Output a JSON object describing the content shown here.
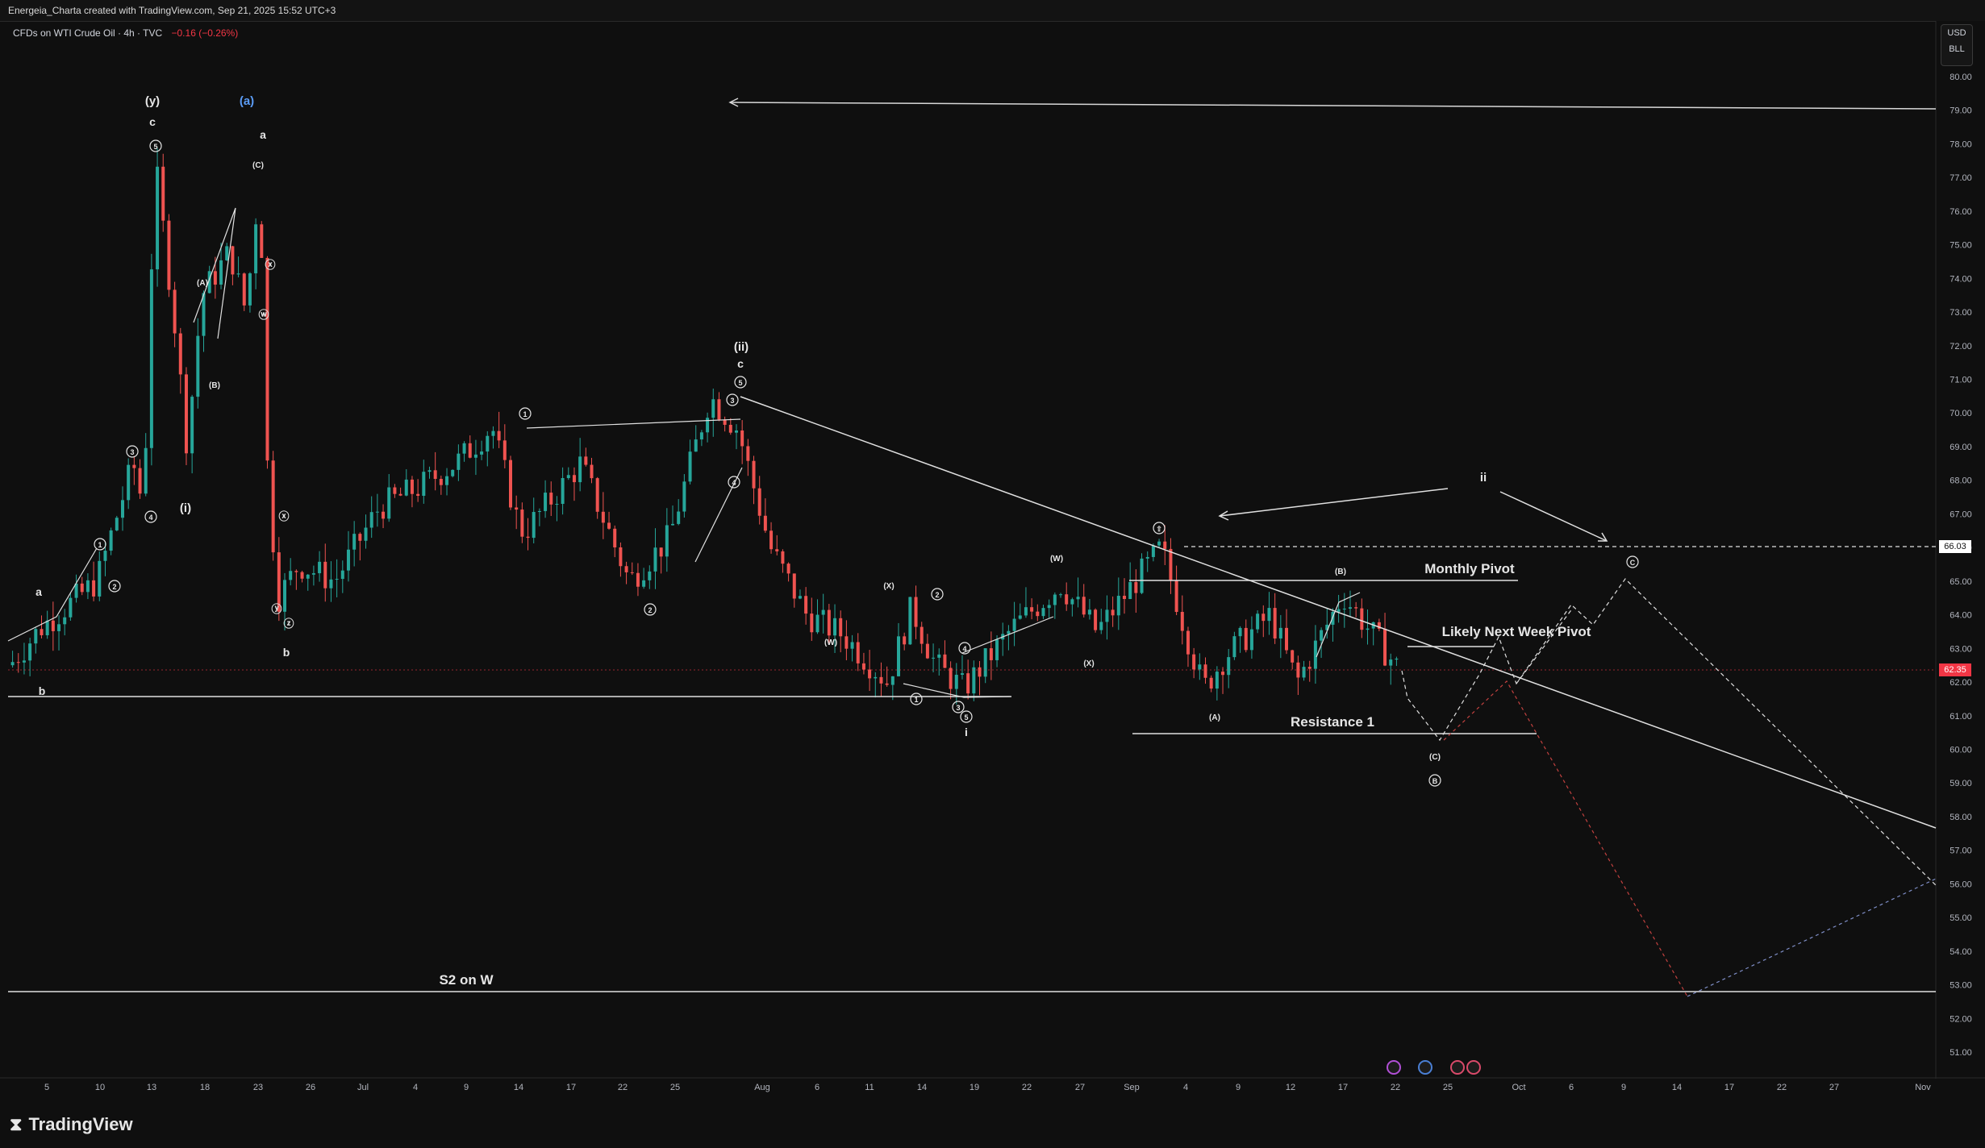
{
  "header": {
    "credit": "Energeia_Charta created with TradingView.com, Sep 21, 2025 15:52 UTC+3"
  },
  "legend": {
    "symbol": "CFDs on WTI Crude Oil · 4h · TVC",
    "change": "−0.16 (−0.26%)"
  },
  "currency": {
    "unit": "USD",
    "sub": "BLL"
  },
  "price_badges": {
    "current": "62.35",
    "level": "66.03",
    "current_color": "#f23645",
    "level_color": "#ffffff"
  },
  "colors": {
    "up": "#26a69a",
    "down": "#ef5350",
    "background": "#0f0f0f",
    "accent_wave_a": "#5b9cf6"
  },
  "annotations": {
    "monthly_pivot": "Monthly Pivot",
    "next_week_pivot": "Likely Next Week Pivot",
    "resistance": "Resistance 1",
    "s2": "S2 on W"
  },
  "wave_labels": {
    "y": "(y)",
    "c_top": "c",
    "a_blue": "(a)",
    "a_top": "a",
    "C_top": "(C)",
    "A1": "(A)",
    "B1": "(B)",
    "X1": "ⓧ",
    "W1": "ⓦ",
    "i_paren": "(i)",
    "a_left": "a",
    "b_left": "b",
    "b_mid": "b",
    "Y1": "ⓨ",
    "Z1": "ⓩ",
    "X2": "ⓧ",
    "ii_paren": "(ii)",
    "c_ii": "c",
    "W2": "(W)",
    "X3": "(X)",
    "W3": "(W)",
    "X4": "(X)",
    "i_low": "i",
    "A2": "(A)",
    "B2": "(B)",
    "C2": "(C)",
    "ii_small": "ii"
  },
  "chart_data": {
    "type": "candlestick",
    "title": "CFDs on WTI Crude Oil · 4h · TVC",
    "ylim": [
      50.3,
      80.6
    ],
    "y_ticks": [
      "80.00",
      "79.00",
      "78.00",
      "77.00",
      "76.00",
      "75.00",
      "74.00",
      "73.00",
      "72.00",
      "71.00",
      "70.00",
      "69.00",
      "68.00",
      "67.00",
      "66.00",
      "65.00",
      "64.00",
      "63.00",
      "62.00",
      "61.00",
      "60.00",
      "59.00",
      "58.00",
      "57.00",
      "56.00",
      "55.00",
      "54.00",
      "53.00",
      "52.00",
      "51.00"
    ],
    "x_ticks": [
      "5",
      "10",
      "13",
      "18",
      "23",
      "26",
      "Jul",
      "4",
      "9",
      "14",
      "17",
      "22",
      "25",
      "Aug",
      "6",
      "11",
      "14",
      "19",
      "22",
      "27",
      "Sep",
      "4",
      "9",
      "12",
      "17",
      "22",
      "25",
      "Oct",
      "6",
      "9",
      "14",
      "17",
      "22",
      "27",
      "Nov"
    ],
    "horizontal_levels": {
      "s2_weekly": 52.8,
      "monthly_pivot": 65.0,
      "next_week_pivot": 63.0,
      "resistance_1": 60.5,
      "dashed_level": 66.03,
      "current": 62.35,
      "base_support": 61.55,
      "top_arrow": 79.2
    },
    "price_path": [
      {
        "d": "Jun 3",
        "p": 62.5
      },
      {
        "d": "Jun 5",
        "p": 63.6
      },
      {
        "d": "Jun 10",
        "p": 65.0
      },
      {
        "d": "Jun 11",
        "p": 68.5
      },
      {
        "d": "Jun 12",
        "p": 67.2
      },
      {
        "d": "Jun 13",
        "p": 77.5
      },
      {
        "d": "Jun 14",
        "p": 73.0
      },
      {
        "d": "Jun 16",
        "p": 69.0
      },
      {
        "d": "Jun 18",
        "p": 73.5
      },
      {
        "d": "Jun 20",
        "p": 74.8
      },
      {
        "d": "Jun 22",
        "p": 73.0
      },
      {
        "d": "Jun 23",
        "p": 77.0
      },
      {
        "d": "Jun 24",
        "p": 68.0
      },
      {
        "d": "Jun 25",
        "p": 64.5
      },
      {
        "d": "Jun 27",
        "p": 65.5
      },
      {
        "d": "Jul 1",
        "p": 65.0
      },
      {
        "d": "Jul 3",
        "p": 67.2
      },
      {
        "d": "Jul 7",
        "p": 67.8
      },
      {
        "d": "Jul 10",
        "p": 68.6
      },
      {
        "d": "Jul 14",
        "p": 69.6
      },
      {
        "d": "Jul 15",
        "p": 66.5
      },
      {
        "d": "Jul 18",
        "p": 66.6
      },
      {
        "d": "Jul 21",
        "p": 68.5
      },
      {
        "d": "Jul 24",
        "p": 65.0
      },
      {
        "d": "Jul 28",
        "p": 66.3
      },
      {
        "d": "Jul 30",
        "p": 70.5
      },
      {
        "d": "Aug 1",
        "p": 69.5
      },
      {
        "d": "Aug 4",
        "p": 66.0
      },
      {
        "d": "Aug 6",
        "p": 64.0
      },
      {
        "d": "Aug 8",
        "p": 63.4
      },
      {
        "d": "Aug 12",
        "p": 62.0
      },
      {
        "d": "Aug 13",
        "p": 64.2
      },
      {
        "d": "Aug 15",
        "p": 62.5
      },
      {
        "d": "Aug 18",
        "p": 61.8
      },
      {
        "d": "Aug 21",
        "p": 63.6
      },
      {
        "d": "Aug 25",
        "p": 64.9
      },
      {
        "d": "Aug 28",
        "p": 63.5
      },
      {
        "d": "Sep 2",
        "p": 66.0
      },
      {
        "d": "Sep 4",
        "p": 63.5
      },
      {
        "d": "Sep 5",
        "p": 61.8
      },
      {
        "d": "Sep 9",
        "p": 62.8
      },
      {
        "d": "Sep 11",
        "p": 64.0
      },
      {
        "d": "Sep 12",
        "p": 62.0
      },
      {
        "d": "Sep 16",
        "p": 64.6
      },
      {
        "d": "Sep 19",
        "p": 62.35
      }
    ]
  }
}
